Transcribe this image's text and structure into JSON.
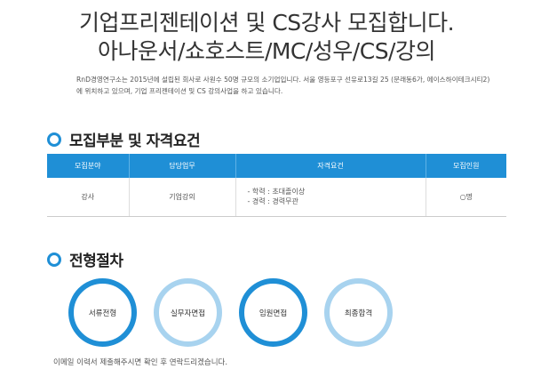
{
  "header": {
    "title_line1": "기업프리젠테이션 및 CS강사 모집합니다.",
    "title_line2": "아나운서/쇼호스트/MC/성우/CS/강의"
  },
  "intro": {
    "text": "RnD경영연구소는 2015년에 설립된 회사로 사원수 50명 규모의 소기업입니다. 서울 영등포구 선유로13길 25 (문래동6가, 에이스하이테크시티2)에 위치하고 있으며, 기업 프리젠테이션 및 CS 강의사업을 하고 있습니다."
  },
  "recruitment": {
    "section_title": "모집부분 및 자격요건",
    "columns": [
      "모집분야",
      "담당업무",
      "자격요건",
      "모집인원"
    ],
    "row": {
      "field": "강사",
      "duty": "기업강의",
      "req_line1": "- 학력 : 초대졸이상",
      "req_line2": "- 경력 : 경력무관",
      "count": "○명"
    }
  },
  "process": {
    "section_title": "전형절차",
    "steps": [
      "서류전형",
      "실무자면접",
      "임원면접",
      "최종합격"
    ],
    "note": "이메일 이력서 제출해주시면 확인 후 연락드리겠습니다."
  },
  "colors": {
    "accent": "#1f8fd6",
    "accent_light": "#a8d3ef"
  },
  "icons": {
    "section_marker": "ring-bullet-icon"
  }
}
